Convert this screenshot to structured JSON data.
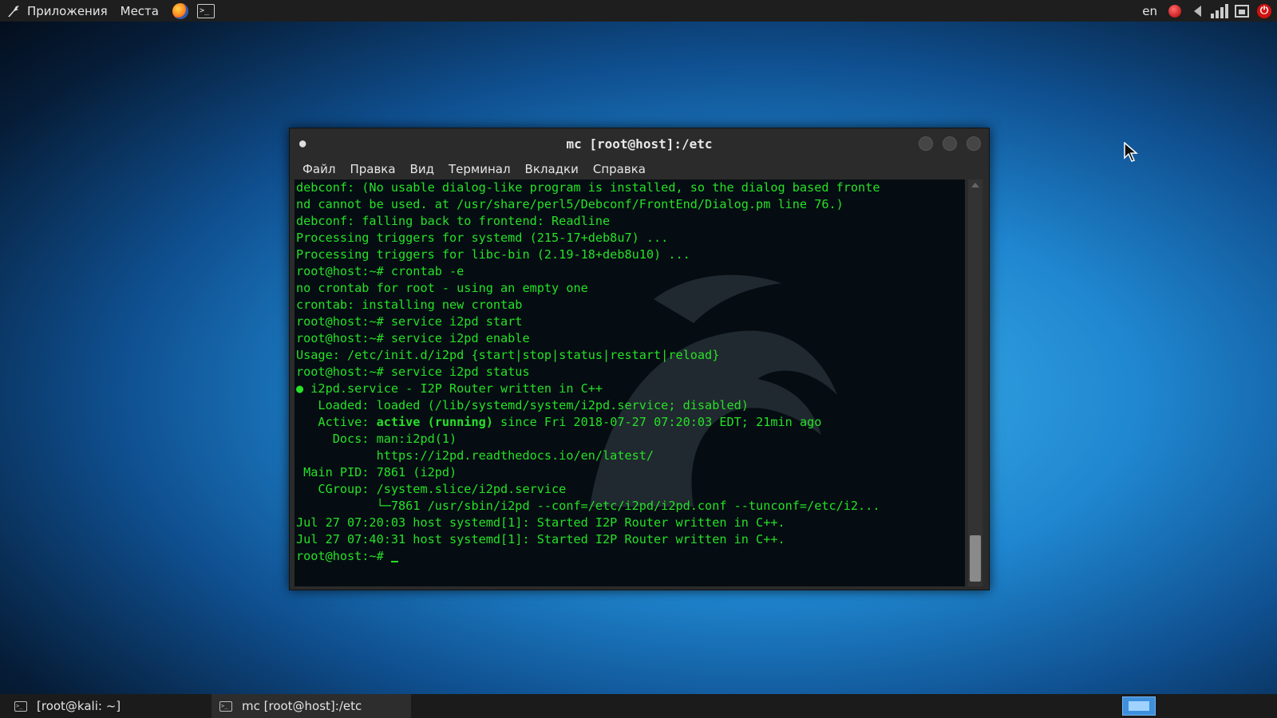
{
  "top_panel": {
    "applications_label": "Приложения",
    "places_label": "Места",
    "tray": {
      "lang": "en"
    }
  },
  "window": {
    "title": "mc [root@host]:/etc",
    "menu": [
      "Файл",
      "Правка",
      "Вид",
      "Терминал",
      "Вкладки",
      "Справка"
    ]
  },
  "terminal": {
    "lines": [
      "debconf: (No usable dialog-like program is installed, so the dialog based fronte",
      "nd cannot be used. at /usr/share/perl5/Debconf/FrontEnd/Dialog.pm line 76.)",
      "debconf: falling back to frontend: Readline",
      "Processing triggers for systemd (215-17+deb8u7) ...",
      "Processing triggers for libc-bin (2.19-18+deb8u10) ...",
      "root@host:~# crontab -e",
      "no crontab for root - using an empty one",
      "crontab: installing new crontab",
      "root@host:~# service i2pd start",
      "root@host:~# service i2pd enable",
      "Usage: /etc/init.d/i2pd {start|stop|status|restart|reload}",
      "root@host:~# service i2pd status",
      "● i2pd.service - I2P Router written in C++",
      "   Loaded: loaded (/lib/systemd/system/i2pd.service; disabled)",
      "   Active: ",
      "     Docs: man:i2pd(1)",
      "           https://i2pd.readthedocs.io/en/latest/",
      " Main PID: 7861 (i2pd)",
      "   CGroup: /system.slice/i2pd.service",
      "           └─7861 /usr/sbin/i2pd --conf=/etc/i2pd/i2pd.conf --tunconf=/etc/i2...",
      "",
      "Jul 27 07:20:03 host systemd[1]: Started I2P Router written in C++.",
      "Jul 27 07:40:31 host systemd[1]: Started I2P Router written in C++.",
      "root@host:~# "
    ],
    "active_state": "active (running)",
    "active_rest": " since Fri 2018-07-27 07:20:03 EDT; 21min ago"
  },
  "taskbar": {
    "tasks": [
      "[root@kali: ~]",
      "mc [root@host]:/etc"
    ]
  },
  "colors": {
    "terminal_text": "#27e027",
    "terminal_bg": "#050d12",
    "desktop_accent": "#1f86cf"
  }
}
